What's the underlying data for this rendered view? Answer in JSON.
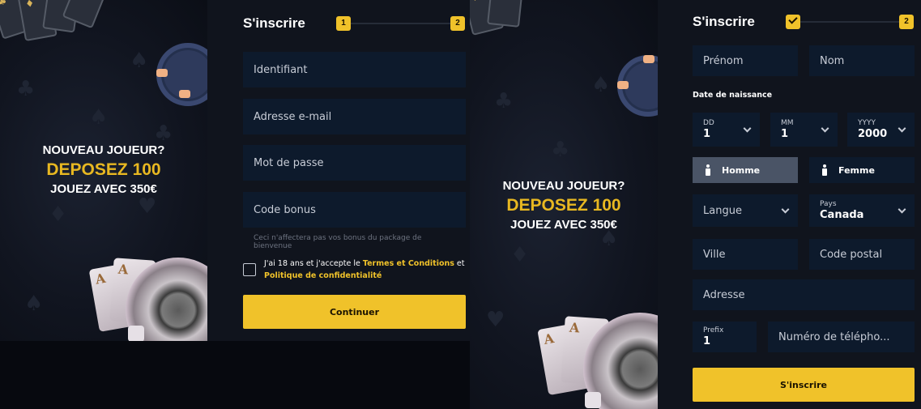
{
  "promo": {
    "line1": "NOUVEAU JOUEUR?",
    "line2": "DEPOSEZ 100",
    "line3": "JOUEZ AVEC 350€"
  },
  "form1": {
    "title": "S'inscrire",
    "step1": "1",
    "step2": "2",
    "username": "Identifiant",
    "email": "Adresse e-mail",
    "password": "Mot de passe",
    "bonus": "Code bonus",
    "bonus_note": "Ceci n'affectera pas vos bonus du package de bienvenue",
    "terms_prefix": "J'ai 18 ans et j'accepte le ",
    "terms_link": "Termes et Conditions",
    "terms_mid": " et ",
    "privacy_link": "Politique de confidentialité",
    "continue": "Continuer"
  },
  "form2": {
    "title": "S'inscrire",
    "step2": "2",
    "firstname": "Prénom",
    "lastname": "Nom",
    "dob_label": "Date de naissance",
    "day_label": "DD",
    "day_value": "1",
    "month_label": "MM",
    "month_value": "1",
    "year_label": "YYYY",
    "year_value": "2000",
    "male": "Homme",
    "female": "Femme",
    "language": "Langue",
    "country_label": "Pays",
    "country_value": "Canada",
    "city": "Ville",
    "postal": "Code postal",
    "address": "Adresse",
    "prefix_label": "Prefix",
    "prefix_value": "1",
    "phone": "Numéro de télépho...",
    "submit": "S'inscrire"
  },
  "colors": {
    "accent": "#f0c22a",
    "field_bg": "#0d1a2c",
    "panel_bg": "#10141d",
    "promo_gold": "#e8b821"
  }
}
